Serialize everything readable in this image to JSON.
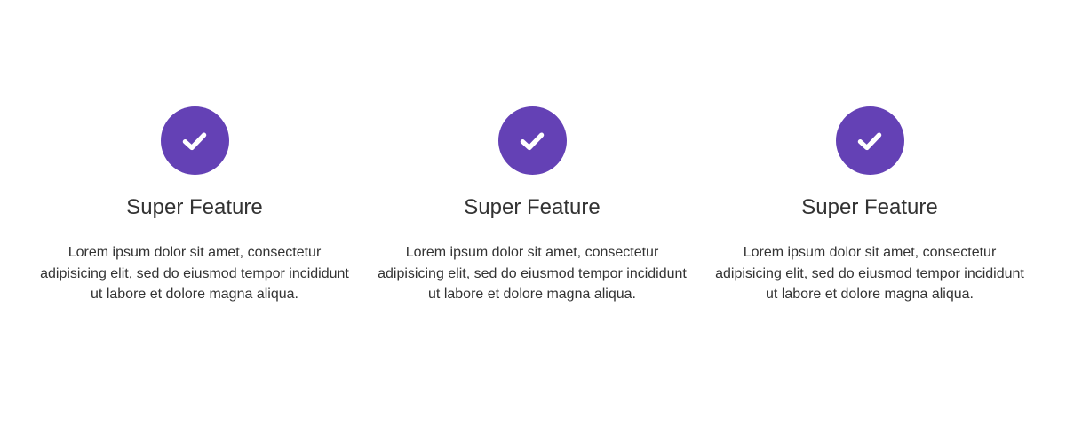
{
  "theme": {
    "accent": "#6441b5"
  },
  "features": [
    {
      "icon": "check-icon",
      "title": "Super Feature",
      "text": "Lorem ipsum dolor sit amet, consectetur adipisicing elit, sed do eiusmod tempor incididunt ut labore et dolore magna aliqua."
    },
    {
      "icon": "check-icon",
      "title": "Super Feature",
      "text": "Lorem ipsum dolor sit amet, consectetur adipisicing elit, sed do eiusmod tempor incididunt ut labore et dolore magna aliqua."
    },
    {
      "icon": "check-icon",
      "title": "Super Feature",
      "text": "Lorem ipsum dolor sit amet, consectetur adipisicing elit, sed do eiusmod tempor incididunt ut labore et dolore magna aliqua."
    }
  ]
}
